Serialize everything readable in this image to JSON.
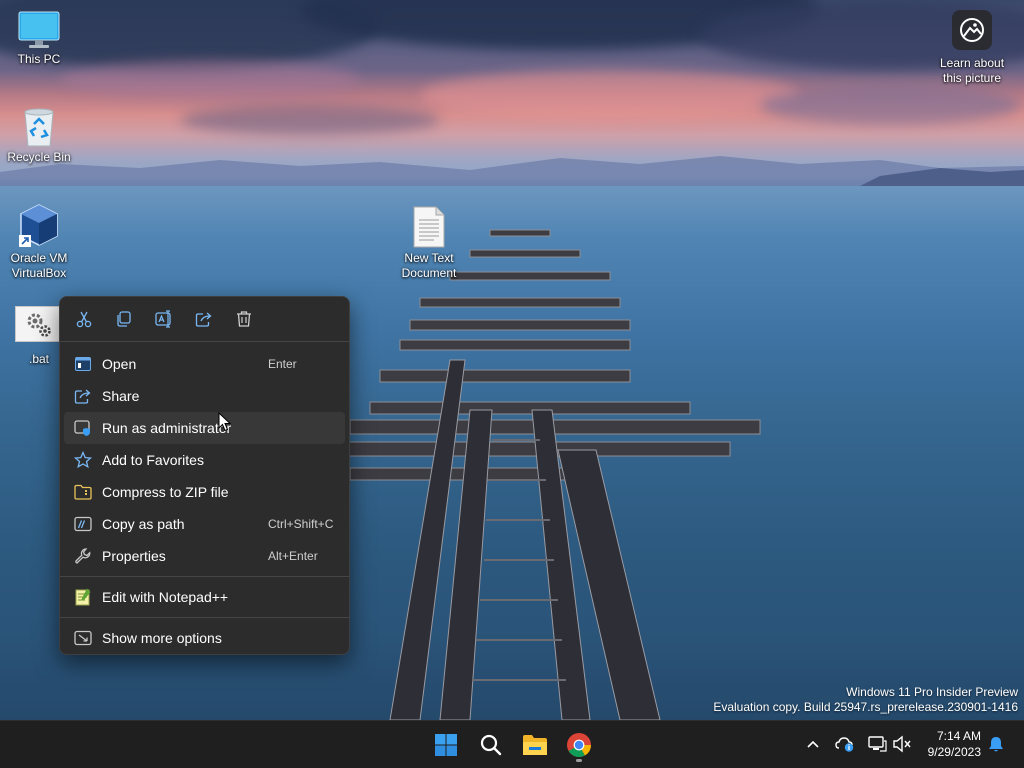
{
  "desktop": {
    "icons": [
      {
        "label": "This PC"
      },
      {
        "label": "Recycle Bin"
      },
      {
        "label": "Oracle VM\nVirtualBox"
      },
      {
        "label": ".bat"
      },
      {
        "label": "New Text\nDocument"
      }
    ],
    "learn_label": "Learn about\nthis picture"
  },
  "watermark": {
    "line1": "Windows 11 Pro Insider Preview",
    "line2": "Evaluation copy. Build 25947.rs_prerelease.230901-1416"
  },
  "context_menu": {
    "toolbar": [
      "cut-icon",
      "copy-icon",
      "rename-icon",
      "share-icon",
      "delete-icon"
    ],
    "items": [
      {
        "label": "Open",
        "shortcut": "Enter",
        "icon": "open-icon"
      },
      {
        "label": "Share",
        "shortcut": "",
        "icon": "share-icon"
      },
      {
        "label": "Run as administrator",
        "shortcut": "",
        "icon": "shield-icon"
      },
      {
        "label": "Add to Favorites",
        "shortcut": "",
        "icon": "star-icon"
      },
      {
        "label": "Compress to ZIP file",
        "shortcut": "",
        "icon": "zip-icon"
      },
      {
        "label": "Copy as path",
        "shortcut": "Ctrl+Shift+C",
        "icon": "path-icon"
      },
      {
        "label": "Properties",
        "shortcut": "Alt+Enter",
        "icon": "wrench-icon"
      },
      {
        "label": "Edit with Notepad++",
        "shortcut": "",
        "icon": "notepadpp-icon"
      },
      {
        "label": "Show more options",
        "shortcut": "",
        "icon": "more-options-icon"
      }
    ]
  },
  "taskbar": {
    "apps": [
      "start-icon",
      "search-icon",
      "file-explorer-icon",
      "chrome-icon"
    ],
    "time": "7:14 AM",
    "date": "9/29/2023"
  },
  "colors": {
    "menu_bg": "#2c2c2c",
    "menu_hover": "#383838",
    "taskbar_bg": "#1f1f1f",
    "accent": "#3a9ef5"
  }
}
